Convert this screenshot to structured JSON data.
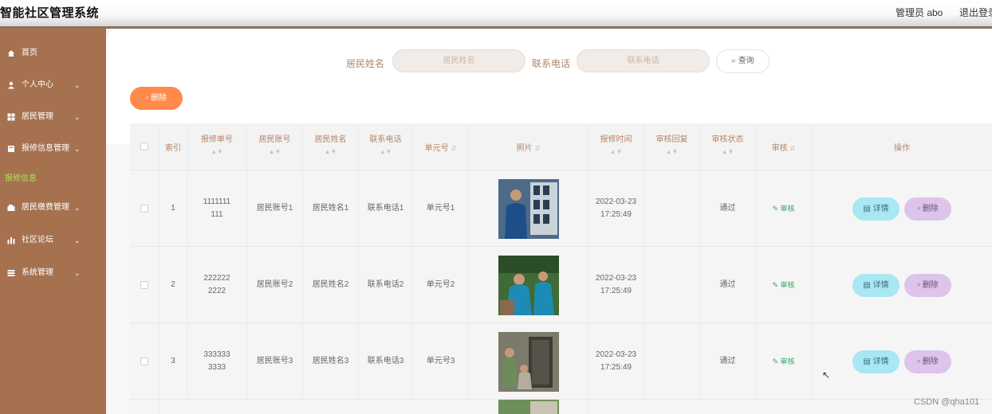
{
  "header": {
    "title": "智能社区管理系统",
    "admin": "管理员 abo",
    "logout": "退出登录"
  },
  "sidebar": {
    "items": [
      {
        "label": "首页",
        "icon": "home-icon",
        "chevron": ""
      },
      {
        "label": "个人中心",
        "icon": "user-icon",
        "chevron": "⌄"
      },
      {
        "label": "居民管理",
        "icon": "grid-icon",
        "chevron": "⌄"
      },
      {
        "label": "报修信息管理",
        "icon": "doc-icon",
        "chevron": "⌄"
      },
      {
        "label": "报修信息",
        "icon": "",
        "chevron": ""
      },
      {
        "label": "居民缴费管理",
        "icon": "wallet-icon",
        "chevron": "⌄"
      },
      {
        "label": "社区论坛",
        "icon": "chart-icon",
        "chevron": "⌄"
      },
      {
        "label": "系统管理",
        "icon": "menu-icon",
        "chevron": "⌄"
      }
    ]
  },
  "search": {
    "name_label": "居民姓名",
    "name_placeholder": "居民姓名",
    "phone_label": "联系电话",
    "phone_placeholder": "联系电话",
    "query_button": "查询"
  },
  "toolbar": {
    "delete_button": "删除"
  },
  "table": {
    "headers": [
      "索引",
      "报修单号",
      "居民账号",
      "居民姓名",
      "联系电话",
      "单元号",
      "照片",
      "报修时间",
      "审核回复",
      "审核状态",
      "审核",
      "操作"
    ],
    "rows": [
      {
        "index": "1",
        "order_no": "1111111111",
        "account": "居民账号1",
        "name": "居民姓名1",
        "phone": "联系电话1",
        "unit": "单元号1",
        "time": "2022-03-23 17:25:49",
        "reply": "",
        "status": "通过",
        "audit": "审核",
        "detail": "详情",
        "remove": "删除",
        "photo_colors": [
          "#5f7f9a",
          "#2b3c55",
          "#c9d2d9"
        ]
      },
      {
        "index": "2",
        "order_no": "2222222222",
        "account": "居民账号2",
        "name": "居民姓名2",
        "phone": "联系电话2",
        "unit": "单元号2",
        "time": "2022-03-23 17:25:49",
        "reply": "",
        "status": "通过",
        "audit": "审核",
        "detail": "详情",
        "remove": "删除",
        "photo_colors": [
          "#3f6b35",
          "#1d8bb5",
          "#2c4d2a"
        ]
      },
      {
        "index": "3",
        "order_no": "3333333333",
        "account": "居民账号3",
        "name": "居民姓名3",
        "phone": "联系电话3",
        "unit": "单元号3",
        "time": "2022-03-23 17:25:49",
        "reply": "",
        "status": "通过",
        "audit": "审核",
        "detail": "详情",
        "remove": "删除",
        "photo_colors": [
          "#7c7a6a",
          "#3e3b33",
          "#b4ad9b"
        ]
      }
    ]
  },
  "watermark": "CSDN @qha101",
  "colors": {
    "sidebar": "#a6714f",
    "accent_orange": "#ff8a4a",
    "detail_btn": "#a9e7f2",
    "delete_btn": "#dcc4ea"
  }
}
